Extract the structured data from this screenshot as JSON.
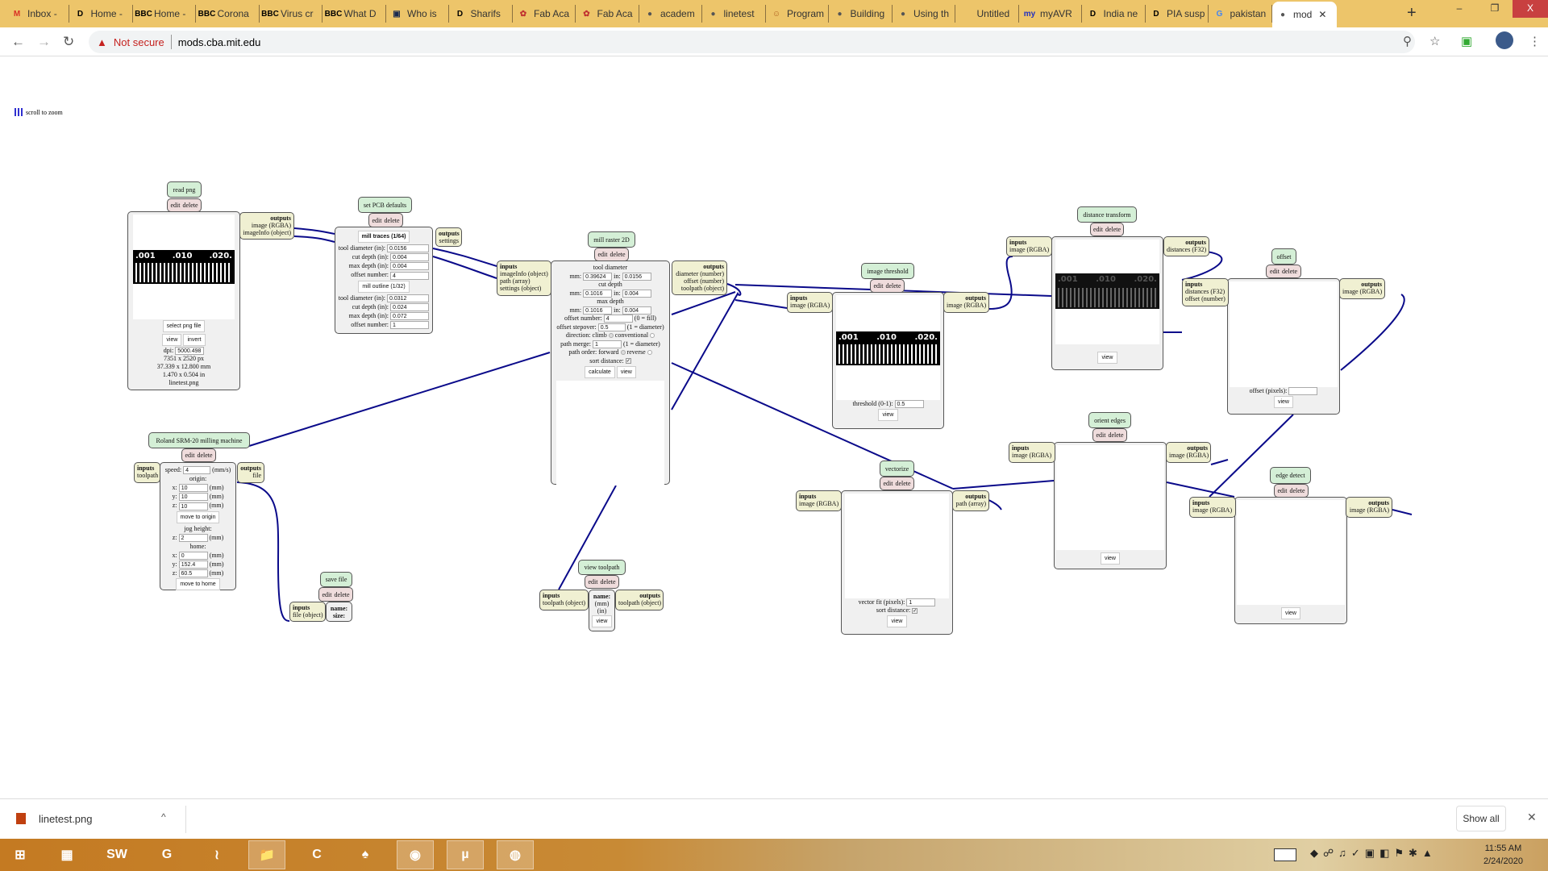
{
  "browser": {
    "tabs": [
      {
        "label": "Inbox -",
        "icon": "gmail-icon",
        "glyph": "M",
        "color": "#d93025"
      },
      {
        "label": "Home -",
        "icon": "dawn-icon",
        "glyph": "D",
        "color": "#000"
      },
      {
        "label": "Home -",
        "icon": "bbc-icon",
        "glyph": "BBC",
        "color": "#000"
      },
      {
        "label": "Corona",
        "icon": "bbc-icon",
        "glyph": "BBC",
        "color": "#000"
      },
      {
        "label": "Virus cr",
        "icon": "bbc-icon",
        "glyph": "BBC",
        "color": "#000"
      },
      {
        "label": "What D",
        "icon": "bbc-icon",
        "glyph": "BBC",
        "color": "#000"
      },
      {
        "label": "Who is",
        "icon": "news-icon",
        "glyph": "▣",
        "color": "#1a2a50"
      },
      {
        "label": "Sharifs",
        "icon": "dawn-icon",
        "glyph": "D",
        "color": "#000"
      },
      {
        "label": "Fab Aca",
        "icon": "fab-academy-icon",
        "glyph": "✿",
        "color": "#c03030"
      },
      {
        "label": "Fab Aca",
        "icon": "fab-academy-icon",
        "glyph": "✿",
        "color": "#c03030"
      },
      {
        "label": "academ",
        "icon": "globe-icon",
        "glyph": "●",
        "color": "#555"
      },
      {
        "label": "linetest",
        "icon": "globe-icon",
        "glyph": "●",
        "color": "#555"
      },
      {
        "label": "Program",
        "icon": "program-icon",
        "glyph": "☺",
        "color": "#b06020"
      },
      {
        "label": "Building",
        "icon": "globe-icon",
        "glyph": "●",
        "color": "#555"
      },
      {
        "label": "Using th",
        "icon": "globe-icon",
        "glyph": "●",
        "color": "#555"
      },
      {
        "label": "Untitled",
        "icon": "blank-icon",
        "glyph": "",
        "color": "#555"
      },
      {
        "label": "myAVR",
        "icon": "myavr-icon",
        "glyph": "my",
        "color": "#2030c0"
      },
      {
        "label": "India ne",
        "icon": "dawn-icon",
        "glyph": "D",
        "color": "#000"
      },
      {
        "label": "PIA susp",
        "icon": "dawn-icon",
        "glyph": "D",
        "color": "#000"
      },
      {
        "label": "pakistan",
        "icon": "google-icon",
        "glyph": "G",
        "color": "#4285f4"
      },
      {
        "label": "mod",
        "icon": "globe-icon",
        "glyph": "●",
        "color": "#555"
      }
    ],
    "new_tab": "+",
    "window": {
      "minimize": "–",
      "maximize": "❐",
      "close": "X"
    },
    "address": {
      "warning": "Not secure",
      "url": "mods.cba.mit.edu"
    }
  },
  "page": {
    "hint": "scroll to zoom"
  },
  "common": {
    "edit": "edit",
    "delete": "delete",
    "inputs": "inputs",
    "outputs": "outputs",
    "view": "view"
  },
  "nodes": {
    "read_png": {
      "title": "read png",
      "outputs": [
        "image (RGBA)",
        "imageInfo (object)"
      ],
      "image_labels": [
        ".001",
        ".010",
        ".020."
      ],
      "select": "select png file",
      "invert": "invert",
      "dpi_label": "dpi:",
      "dpi": "5000.498",
      "info": [
        "7351 x 2520 px",
        "37.339 x 12.800 mm",
        "1.470 x 0.504 in",
        "linetest.png"
      ]
    },
    "set_pcb": {
      "title": "set PCB defaults",
      "outputs": [
        "settings"
      ],
      "traces_btn": "mill traces (1/64)",
      "outline_btn": "mill outline (1/32)",
      "traces": [
        {
          "label": "tool diameter (in):",
          "value": "0.0156"
        },
        {
          "label": "cut depth (in):",
          "value": "0.004"
        },
        {
          "label": "max depth (in):",
          "value": "0.004"
        },
        {
          "label": "offset number:",
          "value": "4"
        }
      ],
      "outline": [
        {
          "label": "tool diameter (in):",
          "value": "0.0312"
        },
        {
          "label": "cut depth (in):",
          "value": "0.024"
        },
        {
          "label": "max depth (in):",
          "value": "0.072"
        },
        {
          "label": "offset number:",
          "value": "1"
        }
      ]
    },
    "mill_raster": {
      "title": "mill raster 2D",
      "inputs": [
        "imageInfo (object)",
        "path (array)",
        "settings (object)"
      ],
      "outputs": [
        "diameter (number)",
        "offset (number)",
        "toolpath (object)"
      ],
      "mm": "mm:",
      "in": "in:",
      "tool_diameter": {
        "label": "tool diameter",
        "mm": "0.39624",
        "in": "0.0156"
      },
      "cut_depth": {
        "label": "cut depth",
        "mm": "0.1016",
        "in": "0.004"
      },
      "max_depth": {
        "label": "max depth",
        "mm": "0.1016",
        "in": "0.004"
      },
      "offset_number": {
        "label": "offset number:",
        "value": "4",
        "note": "(0 = fill)"
      },
      "offset_stepover": {
        "label": "offset stepover:",
        "value": "0.5",
        "note": "(1 = diameter)"
      },
      "direction": {
        "label": "direction:",
        "opt1": "climb",
        "opt2": "conventional"
      },
      "path_merge": {
        "label": "path merge:",
        "value": "1",
        "note": "(1 = diameter)"
      },
      "path_order": {
        "label": "path order:",
        "opt1": "forward",
        "opt2": "reverse"
      },
      "sort_distance": "sort distance:",
      "calculate": "calculate"
    },
    "roland": {
      "title": "Roland SRM-20 milling machine",
      "inputs": [
        "toolpath"
      ],
      "outputs": [
        "file"
      ],
      "speed_label": "speed:",
      "speed": "4",
      "speed_unit": "(mm/s)",
      "origin": "origin:",
      "unit": "(mm)",
      "origin_vals": [
        {
          "axis": "x:",
          "value": "10"
        },
        {
          "axis": "y:",
          "value": "10"
        },
        {
          "axis": "z:",
          "value": "10"
        }
      ],
      "move_origin": "move to origin",
      "jog": "jog height:",
      "jog_val": {
        "axis": "z:",
        "value": "2"
      },
      "home": "home:",
      "home_vals": [
        {
          "axis": "x:",
          "value": "0"
        },
        {
          "axis": "y:",
          "value": "152.4"
        },
        {
          "axis": "z:",
          "value": "60.5"
        }
      ],
      "move_home": "move to home"
    },
    "save_file": {
      "title": "save file",
      "inputs": [
        "file (object)"
      ],
      "name": "name:",
      "size": "size:"
    },
    "view_toolpath": {
      "title": "view toolpath",
      "inputs": [
        "toolpath (object)"
      ],
      "outputs": [
        "toolpath (object)"
      ],
      "name": "name:",
      "mm": "(mm)",
      "in": "(in)"
    },
    "threshold": {
      "title": "image threshold",
      "inputs": [
        "image (RGBA)"
      ],
      "outputs": [
        "image (RGBA)"
      ],
      "label": "threshold (0-1):",
      "value": "0.5",
      "image_labels": [
        ".001",
        ".010",
        ".020."
      ]
    },
    "vectorize": {
      "title": "vectorize",
      "inputs": [
        "image (RGBA)"
      ],
      "outputs": [
        "path (array)"
      ],
      "fit_label": "vector fit (pixels):",
      "fit": "1",
      "sort": "sort distance:"
    },
    "distance": {
      "title": "distance transform",
      "inputs": [
        "image (RGBA)"
      ],
      "outputs": [
        "distances (F32)"
      ],
      "image_labels": [
        ".001",
        ".010",
        ".020."
      ]
    },
    "offset": {
      "title": "offset",
      "inputs": [
        "distances (F32)",
        "offset (number)"
      ],
      "outputs": [
        "image (RGBA)"
      ],
      "label": "offset (pixels):",
      "value": ""
    },
    "orient": {
      "title": "orient edges",
      "inputs": [
        "image (RGBA)"
      ],
      "outputs": [
        "image (RGBA)"
      ]
    },
    "edge": {
      "title": "edge detect",
      "inputs": [
        "image (RGBA)"
      ],
      "outputs": [
        "image (RGBA)"
      ]
    }
  },
  "downloads": {
    "file": "linetest.png",
    "show_all": "Show all",
    "close": "✕"
  },
  "taskbar": {
    "time": "11:55 AM",
    "date": "2/24/2020",
    "apps": [
      {
        "name": "windows-start",
        "glyph": "⊞"
      },
      {
        "name": "calculator",
        "glyph": "▦"
      },
      {
        "name": "solidworks",
        "glyph": "SW"
      },
      {
        "name": "pdf",
        "glyph": "G"
      },
      {
        "name": "app-orange",
        "glyph": "≀"
      },
      {
        "name": "file-explorer",
        "glyph": "📁"
      },
      {
        "name": "c-app",
        "glyph": "C"
      },
      {
        "name": "inkscape",
        "glyph": "♠"
      },
      {
        "name": "chrome",
        "glyph": "◉"
      },
      {
        "name": "utorrent",
        "glyph": "µ"
      },
      {
        "name": "idm",
        "glyph": "◍"
      }
    ]
  }
}
